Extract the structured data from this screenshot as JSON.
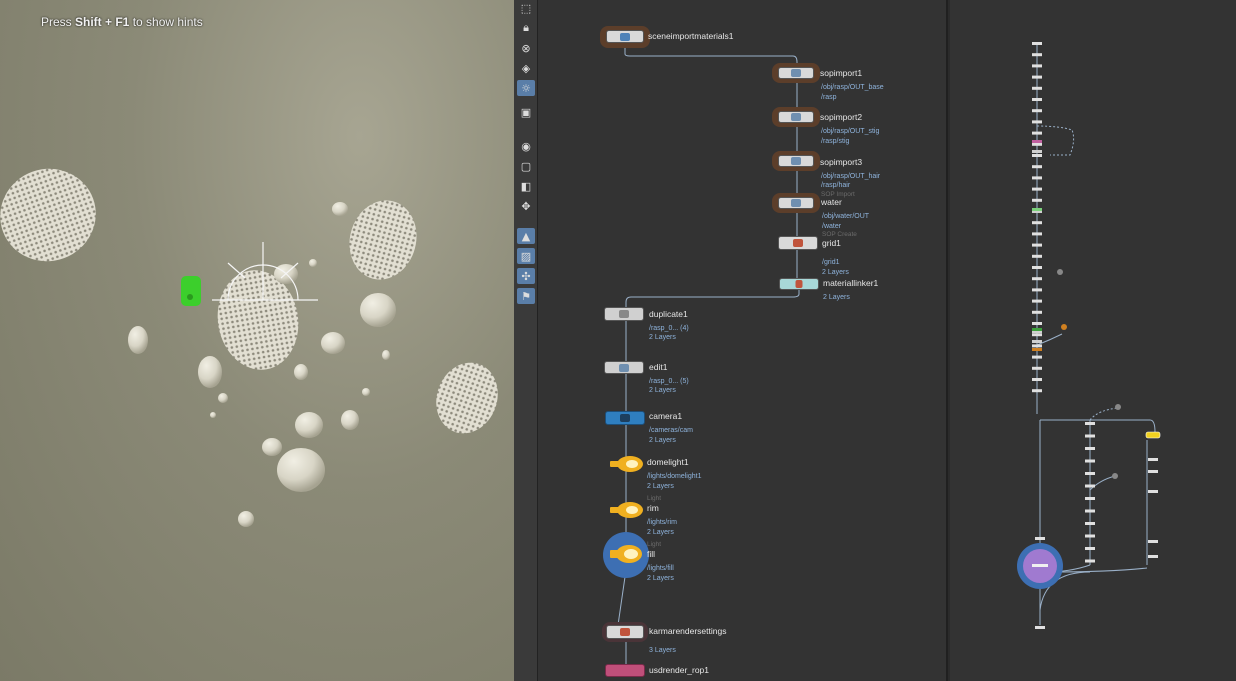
{
  "viewport": {
    "hint_prefix": "Press ",
    "hint_keys": "Shift + F1",
    "hint_suffix": " to show hints"
  },
  "toolbar": {
    "buttons": [
      "select-tool",
      "lock-icon",
      "pose-icon",
      "pin-icon",
      "light-icon",
      "snapshot-icon",
      "visibility-icon",
      "display-icon",
      "render-icon",
      "camera-icon",
      "material-icon",
      "light-link-icon",
      "transform-icon",
      "flag-icon"
    ]
  },
  "network": {
    "nodes": [
      {
        "id": "sceneimportmaterials1",
        "name": "sceneimportmaterials1",
        "sub": [],
        "type": ""
      },
      {
        "id": "sopimport1",
        "name": "sopimport1",
        "sub": [
          "/obj/rasp/OUT_base",
          "/rasp"
        ],
        "type": ""
      },
      {
        "id": "sopimport2",
        "name": "sopimport2",
        "sub": [
          "/obj/rasp/OUT_stig",
          "/rasp/stig"
        ],
        "type": ""
      },
      {
        "id": "sopimport3",
        "name": "sopimport3",
        "sub": [
          "/obj/rasp/OUT_hair",
          "/rasp/hair"
        ],
        "type": "SOP Import"
      },
      {
        "id": "water",
        "name": "water",
        "sub": [
          "/obj/water/OUT",
          "/water"
        ],
        "type": "SOP Create"
      },
      {
        "id": "grid1",
        "name": "grid1",
        "sub": [
          "/grid1",
          "2 Layers"
        ],
        "type": ""
      },
      {
        "id": "materiallinker1",
        "name": "materiallinker1",
        "sub": [
          "2 Layers"
        ],
        "type": ""
      },
      {
        "id": "duplicate1",
        "name": "duplicate1",
        "sub": [
          "/rasp_0... (4)",
          "2 Layers"
        ],
        "type": ""
      },
      {
        "id": "edit1",
        "name": "edit1",
        "sub": [
          "/rasp_0... (5)",
          "2 Layers"
        ],
        "type": ""
      },
      {
        "id": "camera1",
        "name": "camera1",
        "sub": [
          "/cameras/cam",
          "2 Layers"
        ],
        "type": ""
      },
      {
        "id": "domelight1",
        "name": "domelight1",
        "sub": [
          "/lights/domelight1",
          "2 Layers"
        ],
        "type": "Light"
      },
      {
        "id": "rim",
        "name": "rim",
        "sub": [
          "/lights/rim",
          "2 Layers"
        ],
        "type": "Light"
      },
      {
        "id": "fill",
        "name": "fill",
        "sub": [
          "/lights/fill",
          "2 Layers"
        ],
        "type": ""
      },
      {
        "id": "karmarendersettings",
        "name": "karmarendersettings",
        "sub": [
          "3 Layers"
        ],
        "type": ""
      },
      {
        "id": "usdrender_rop1",
        "name": "usdrender_rop1",
        "sub": [],
        "type": ""
      }
    ]
  },
  "colors": {
    "wire": "#9ab0c8",
    "light_node": "#f0b020",
    "camera_node": "#2f7fc0",
    "selected_ring": "#3d6fb3",
    "link_node": "#a8d8d8",
    "rop_node": "#c04f7a",
    "handle_green": "#3ccf2c"
  }
}
